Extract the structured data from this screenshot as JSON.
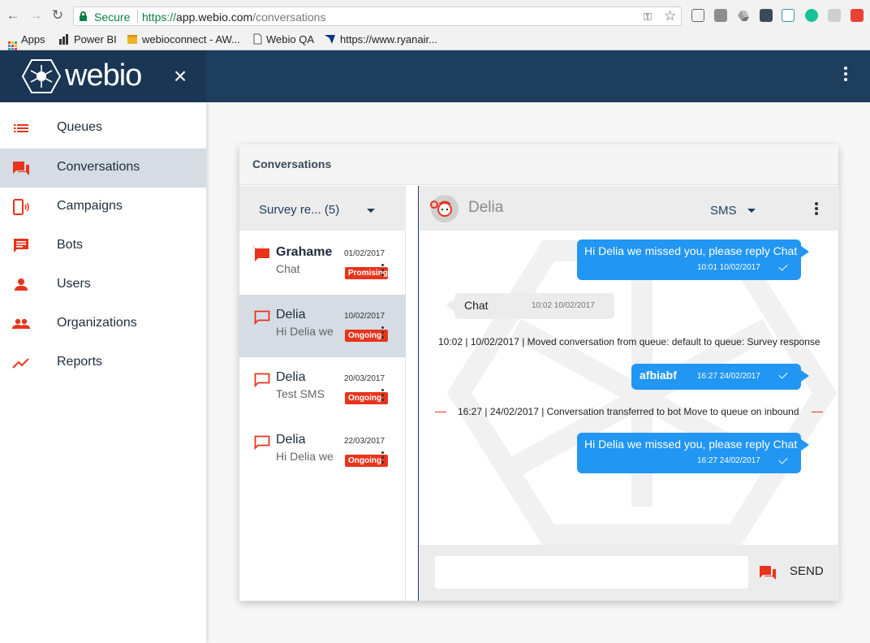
{
  "browser": {
    "secure_label": "Secure",
    "url_scheme": "https://",
    "url_host": "app.webio.com",
    "url_path": "/conversations",
    "bookmarks": [
      {
        "label": "Apps",
        "icon": "apps-grid-icon"
      },
      {
        "label": "Power BI",
        "icon": "power-bi-icon"
      },
      {
        "label": "webioconnect - AW...",
        "icon": "package-icon"
      },
      {
        "label": "Webio QA",
        "icon": "document-icon"
      },
      {
        "label": "https://www.ryanair...",
        "icon": "ryanair-icon"
      }
    ]
  },
  "app": {
    "brand": "webio",
    "colors": {
      "header": "#1e3e5e",
      "accent": "#e8341c",
      "bubble": "#2196f3",
      "selected": "#d5dce3"
    }
  },
  "sidebar": {
    "items": [
      {
        "label": "Queues",
        "icon": "list-icon",
        "active": false
      },
      {
        "label": "Conversations",
        "icon": "forum-icon",
        "active": true
      },
      {
        "label": "Campaigns",
        "icon": "phone-ring-icon",
        "active": false
      },
      {
        "label": "Bots",
        "icon": "message-icon",
        "active": false
      },
      {
        "label": "Users",
        "icon": "person-icon",
        "active": false
      },
      {
        "label": "Organizations",
        "icon": "group-icon",
        "active": false
      },
      {
        "label": "Reports",
        "icon": "trending-icon",
        "active": false
      }
    ]
  },
  "panel": {
    "title": "Conversations",
    "queue_selector": "Survey re... (5)"
  },
  "conversations": [
    {
      "name": "Grahame",
      "preview": "Chat",
      "date": "01/02/2017",
      "status": "Promising",
      "icon": "filled-chat-icon",
      "selected": false
    },
    {
      "name": "Delia",
      "preview": "Hi Delia we missed you",
      "date": "10/02/2017",
      "status": "Ongoing",
      "icon": "outline-chat-icon",
      "selected": true
    },
    {
      "name": "Delia",
      "preview": "Test SMS",
      "date": "20/03/2017",
      "status": "Ongoing",
      "icon": "outline-chat-icon",
      "selected": false
    },
    {
      "name": "Delia",
      "preview": "Hi Delia we missed you",
      "date": "22/03/2017",
      "status": "Ongoing",
      "icon": "outline-chat-icon",
      "selected": false
    }
  ],
  "chat": {
    "contact_name": "Delia",
    "channel": "SMS",
    "messages": [
      {
        "type": "outgoing",
        "text": "Hi Delia we missed you, please reply Chat",
        "time": "10:01 10/02/2017"
      },
      {
        "type": "incoming",
        "text": "Chat",
        "time": "10:02 10/02/2017"
      },
      {
        "type": "system",
        "text": "10:02 | 10/02/2017 | Moved conversation from queue: default to queue: Survey response"
      },
      {
        "type": "outgoing",
        "text": "afbiabf",
        "time": "16:27 24/02/2017"
      },
      {
        "type": "system",
        "text": "16:27 | 24/02/2017 | Conversation transferred to bot Move to queue on inbound"
      },
      {
        "type": "outgoing",
        "text": "Hi Delia we missed you, please reply Chat",
        "time": "16:27 24/02/2017"
      }
    ],
    "compose_placeholder": "",
    "send_label": "SEND"
  }
}
